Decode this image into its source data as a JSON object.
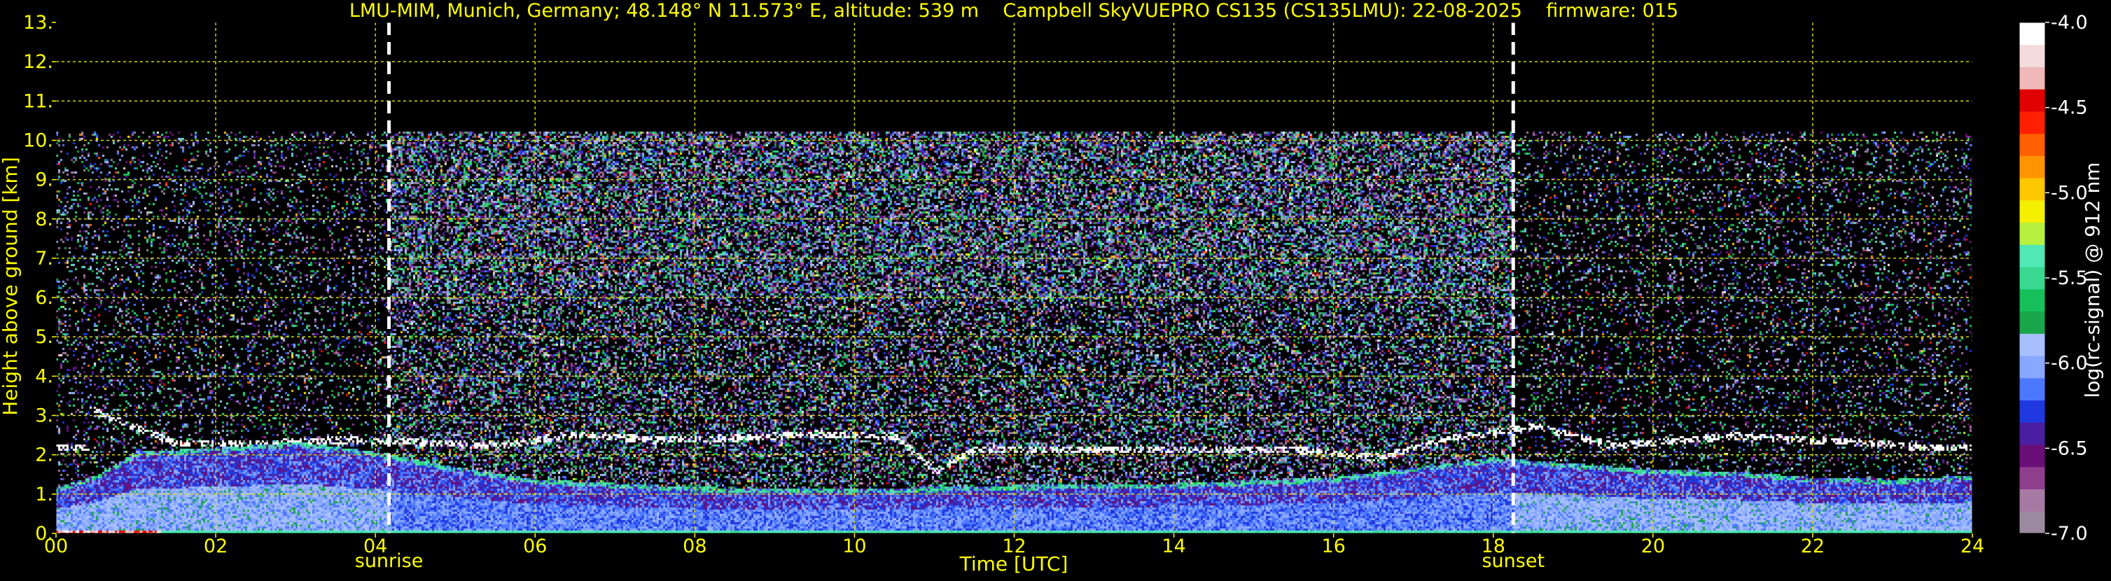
{
  "chart_data": {
    "type": "heatmap",
    "title": "LMU-MIM, Munich, Germany; 48.148° N 11.573° E, altitude: 539 m    Campbell SkyVUEPRO CS135 (CS135LMU): 22-08-2025    firmware: 015",
    "xlabel": "Time [UTC]",
    "ylabel": "Height above ground [km]",
    "colorbar_label": "log(rc-signal) @ 912 nm",
    "xlim": [
      0,
      24
    ],
    "ylim": [
      0,
      13
    ],
    "x_ticks": [
      0,
      2,
      4,
      6,
      8,
      10,
      12,
      14,
      16,
      18,
      20,
      22,
      24
    ],
    "x_tick_labels": [
      "00",
      "02",
      "04",
      "06",
      "08",
      "10",
      "12",
      "14",
      "16",
      "18",
      "20",
      "22",
      "24"
    ],
    "y_ticks": [
      0,
      1,
      2,
      3,
      4,
      5,
      6,
      7,
      8,
      9,
      10,
      11,
      12,
      13
    ],
    "y_tick_labels": [
      "0.",
      "1.",
      "2.",
      "3.",
      "4.",
      "5.",
      "6.",
      "7.",
      "8.",
      "9.",
      "10.",
      "11.",
      "12.",
      "13."
    ],
    "colorbar_range": [
      -7.0,
      -4.0
    ],
    "colorbar_ticks": [
      -7.0,
      -6.5,
      -6.0,
      -5.5,
      -5.0,
      -4.5,
      -4.0
    ],
    "colorbar_tick_labels": [
      "-7.0",
      "-6.5",
      "-6.0",
      "-5.5",
      "-5.0",
      "-4.5",
      "-4.0"
    ],
    "colormap": [
      "#9b8aa0",
      "#a77aa4",
      "#8f3e8e",
      "#6a0f78",
      "#4a1ea0",
      "#2038e0",
      "#4c78ff",
      "#88a8ff",
      "#a8c0ff",
      "#1aa64a",
      "#16c05a",
      "#38d890",
      "#50e8b4",
      "#b8f040",
      "#f4f000",
      "#ffc800",
      "#ff9400",
      "#ff6000",
      "#ff2000",
      "#e00000",
      "#f0b8b8",
      "#f4dcdc",
      "#ffffff"
    ],
    "grid": true,
    "grid_color": "#d8d800",
    "text_color": "#ffff00",
    "vertical_markers": [
      {
        "label": "sunrise",
        "x": 4.17
      },
      {
        "label": "sunset",
        "x": 18.25
      }
    ],
    "signal_top_km": 10.25,
    "features": {
      "aerosol_layer_top_km": [
        [
          0.0,
          1.2
        ],
        [
          0.5,
          1.5
        ],
        [
          1.0,
          2.1
        ],
        [
          2.0,
          2.2
        ],
        [
          3.0,
          2.35
        ],
        [
          4.0,
          2.1
        ],
        [
          5.0,
          1.7
        ],
        [
          6.0,
          1.4
        ],
        [
          8.0,
          1.2
        ],
        [
          10.0,
          1.15
        ],
        [
          12.0,
          1.25
        ],
        [
          14.0,
          1.3
        ],
        [
          16.0,
          1.45
        ],
        [
          17.0,
          1.7
        ],
        [
          18.0,
          1.95
        ],
        [
          19.0,
          1.8
        ],
        [
          20.0,
          1.65
        ],
        [
          21.0,
          1.6
        ],
        [
          22.0,
          1.45
        ],
        [
          23.0,
          1.4
        ],
        [
          24.0,
          1.5
        ]
      ],
      "cloud_base_km": [
        [
          0.4,
          3.2
        ],
        [
          1.5,
          2.3
        ],
        [
          2.5,
          2.3
        ],
        [
          3.5,
          2.4
        ],
        [
          4.5,
          2.35
        ],
        [
          5.5,
          2.25
        ],
        [
          6.5,
          2.55
        ],
        [
          7.5,
          2.4
        ],
        [
          8.5,
          2.45
        ],
        [
          9.5,
          2.55
        ],
        [
          10.5,
          2.5
        ],
        [
          11.0,
          1.6
        ],
        [
          11.5,
          2.15
        ],
        [
          15.5,
          2.15
        ],
        [
          16.5,
          1.95
        ],
        [
          17.5,
          2.45
        ],
        [
          18.5,
          2.75
        ],
        [
          19.5,
          2.25
        ],
        [
          21.0,
          2.5
        ],
        [
          22.5,
          2.35
        ],
        [
          23.5,
          2.2
        ]
      ]
    }
  }
}
